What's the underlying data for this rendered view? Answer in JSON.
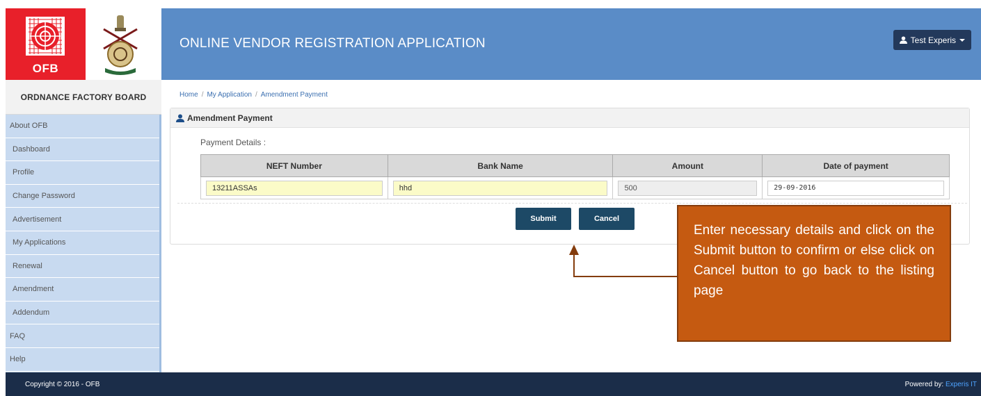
{
  "header": {
    "logo_text": "OFB",
    "app_title": "ONLINE VENDOR REGISTRATION APPLICATION",
    "user_label": "Test Experis"
  },
  "sidebar": {
    "title": "ORDNANCE FACTORY BOARD",
    "items": [
      {
        "label": "About OFB"
      },
      {
        "label": "Dashboard"
      },
      {
        "label": "Profile"
      },
      {
        "label": "Change Password"
      },
      {
        "label": "Advertisement"
      },
      {
        "label": "My Applications"
      },
      {
        "label": "Renewal"
      },
      {
        "label": "Amendment"
      },
      {
        "label": "Addendum"
      },
      {
        "label": "FAQ"
      },
      {
        "label": "Help"
      }
    ]
  },
  "breadcrumb": [
    "Home",
    "My Application",
    "Amendment Payment"
  ],
  "panel": {
    "title": "Amendment Payment",
    "section_label": "Payment Details :",
    "columns": [
      "NEFT Number",
      "Bank Name",
      "Amount",
      "Date of payment"
    ],
    "row": {
      "neft_number": "13211ASSAs",
      "bank_name": "hhd",
      "amount": "500",
      "date_of_payment": "29-09-2016"
    },
    "submit_label": "Submit",
    "cancel_label": "Cancel"
  },
  "callout": {
    "text": "Enter necessary details and click on the Submit button to confirm or else click on Cancel button to go back to the listing page"
  },
  "footer": {
    "copyright": "Copyright © 2016 - OFB",
    "powered_prefix": "Powered by: ",
    "powered_link": "Experis IT"
  },
  "colors": {
    "header_bg": "#5a8cc7",
    "sidebar_bg": "#c8daf0",
    "button_bg": "#1d4966",
    "callout_bg": "#c55a11",
    "footer_bg": "#1b2d49",
    "logo_red": "#e8202a"
  },
  "icons": {
    "user": "user-icon",
    "caret": "caret-down-icon",
    "emblem": "national-emblem-icon",
    "ofb_logo": "ofb-target-logo-icon"
  }
}
